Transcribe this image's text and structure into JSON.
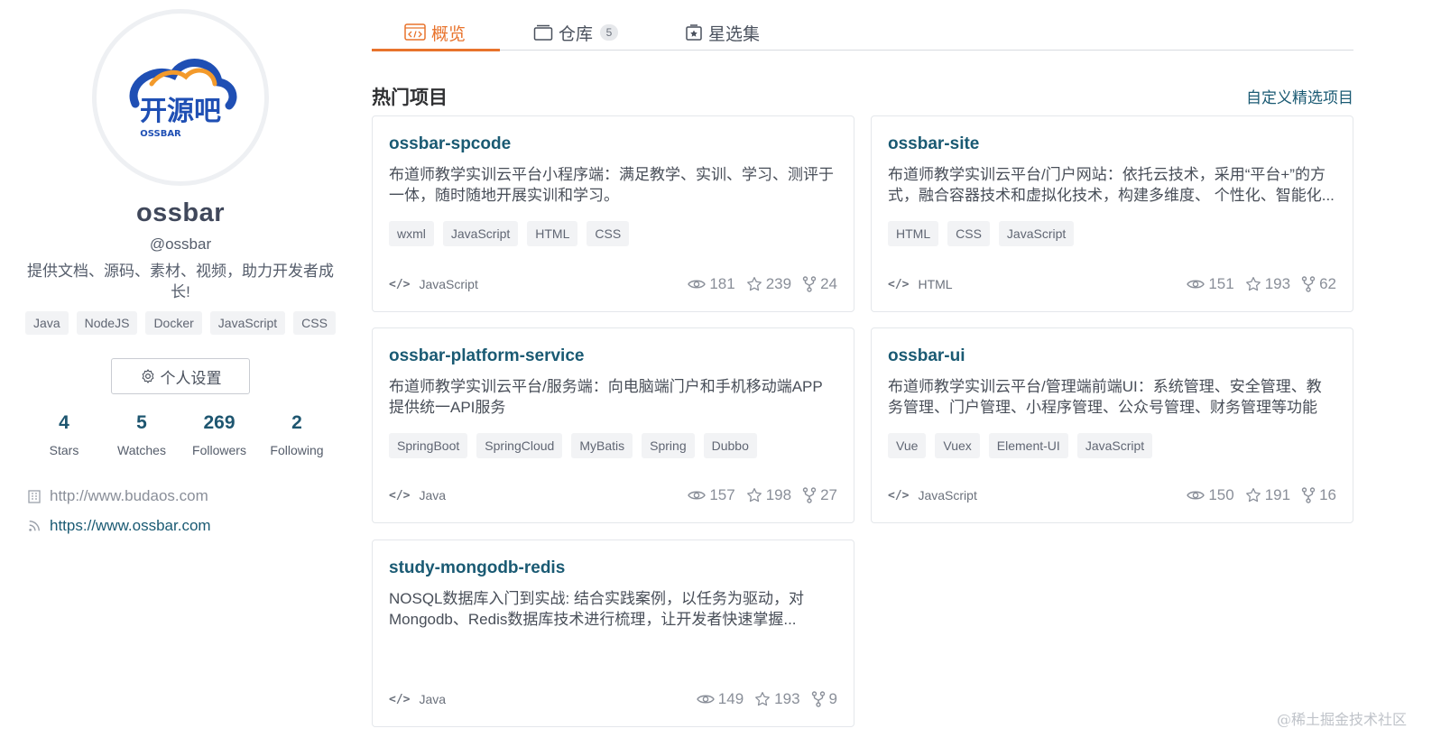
{
  "tabs": [
    {
      "label": "概览",
      "icon": "code-window-icon",
      "active": true
    },
    {
      "label": "仓库",
      "icon": "repo-icon",
      "count": "5"
    },
    {
      "label": "星选集",
      "icon": "star-collection-icon"
    }
  ],
  "profile": {
    "logo_text": "开源吧",
    "logo_sub": "OSSBAR",
    "name": "ossbar",
    "handle": "@ossbar",
    "bio": "提供文档、源码、素材、视频，助力开发者成长!",
    "tags": [
      "Java",
      "NodeJS",
      "Docker",
      "JavaScript",
      "CSS"
    ],
    "settings_label": "个人设置",
    "stats": [
      {
        "value": "4",
        "label": "Stars"
      },
      {
        "value": "5",
        "label": "Watches"
      },
      {
        "value": "269",
        "label": "Followers"
      },
      {
        "value": "2",
        "label": "Following"
      }
    ],
    "links": [
      {
        "text": "http://www.budaos.com",
        "icon": "building-icon"
      },
      {
        "text": "https://www.ossbar.com",
        "icon": "rss-icon"
      }
    ]
  },
  "section": {
    "title": "热门项目",
    "custom_link": "自定义精选项目"
  },
  "projects": [
    {
      "title": "ossbar-spcode",
      "desc": "布道师教学实训云平台小程序端：满足教学、实训、学习、测评于一体，随时随地开展实训和学习。",
      "tags": [
        "wxml",
        "JavaScript",
        "HTML",
        "CSS"
      ],
      "language": "JavaScript",
      "watches": "181",
      "stars": "239",
      "forks": "24"
    },
    {
      "title": "ossbar-site",
      "desc": "布道师教学实训云平台/门户网站：依托云技术，采用“平台+”的方式，融合容器技术和虚拟化技术，构建多维度、 个性化、智能化...",
      "tags": [
        "HTML",
        "CSS",
        "JavaScript"
      ],
      "language": "HTML",
      "watches": "151",
      "stars": "193",
      "forks": "62"
    },
    {
      "title": "ossbar-platform-service",
      "desc": "布道师教学实训云平台/服务端：向电脑端门户和手机移动端APP提供统一API服务",
      "tags": [
        "SpringBoot",
        "SpringCloud",
        "MyBatis",
        "Spring",
        "Dubbo"
      ],
      "language": "Java",
      "watches": "157",
      "stars": "198",
      "forks": "27"
    },
    {
      "title": "ossbar-ui",
      "desc": "布道师教学实训云平台/管理端前端UI：系统管理、安全管理、教务管理、门户管理、小程序管理、公众号管理、财务管理等功能",
      "tags": [
        "Vue",
        "Vuex",
        "Element-UI",
        "JavaScript"
      ],
      "language": "JavaScript",
      "watches": "150",
      "stars": "191",
      "forks": "16"
    },
    {
      "title": "study-mongodb-redis",
      "desc": "NOSQL数据库入门到实战: 结合实践案例，以任务为驱动，对Mongodb、Redis数据库技术进行梳理，让开发者快速掌握...",
      "tags": [],
      "language": "Java",
      "watches": "149",
      "stars": "193",
      "forks": "9"
    }
  ],
  "watermark": "@稀土掘金技术社区",
  "colors": {
    "accent": "#e8732c",
    "link": "#1a5a73",
    "logo_blue": "#1f4fb4",
    "logo_orange": "#f39a2b"
  }
}
